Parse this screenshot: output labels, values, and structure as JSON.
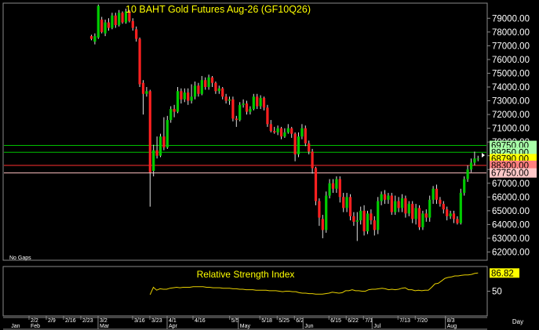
{
  "chart_data": [
    {
      "type": "candlestick",
      "title": "10 BAHT Gold Futures Aug-26 (GF10Q26)",
      "footnote": "No Gaps",
      "ylim": [
        61400,
        80100
      ],
      "y_ticks": [
        62000,
        63000,
        64000,
        65000,
        66000,
        67000,
        68000,
        69000,
        70000,
        71000,
        72000,
        73000,
        74000,
        75000,
        76000,
        77000,
        78000,
        79000
      ],
      "y_tick_labels": [
        "62000.00",
        "63000.00",
        "64000.00",
        "65000.00",
        "66000.00",
        "67000.00",
        "68000.00",
        "69000.00",
        "70000.00",
        "71000.00",
        "72000.00",
        "73000.00",
        "74000.00",
        "75000.00",
        "76000.00",
        "77000.00",
        "78000.00",
        "79000.00"
      ],
      "colors": {
        "up": "#00cc00",
        "down": "#ff2020",
        "wick": "#e0e0e0"
      },
      "levels": [
        {
          "value": 69750,
          "label": "69750.00",
          "color": "#00c000",
          "bg": "#a8ffa8"
        },
        {
          "value": 69250,
          "label": "89250.00",
          "color": "#00c000",
          "bg": "#a8ffa8"
        },
        {
          "value": 68790,
          "label": "68790.00",
          "color": null,
          "bg": "#ffff00"
        },
        {
          "value": 68300,
          "label": "88300.00",
          "color": "#ff3030",
          "bg": "#ff8080"
        },
        {
          "value": 67750,
          "label": "67750.00",
          "color": "#ffc0c0",
          "bg": "#ffc8c8"
        }
      ],
      "candles": [
        [
          0,
          77700,
          77500,
          77800,
          77400
        ],
        [
          1,
          77300,
          77700,
          77900,
          77100
        ],
        [
          2,
          77600,
          79900,
          80000,
          77500
        ],
        [
          3,
          78900,
          78000,
          79100,
          77900
        ],
        [
          4,
          77900,
          78700,
          78900,
          77700
        ],
        [
          5,
          78700,
          78300,
          79000,
          78100
        ],
        [
          6,
          78300,
          79200,
          79400,
          78200
        ],
        [
          7,
          79200,
          78500,
          79400,
          78300
        ],
        [
          8,
          78500,
          79400,
          79600,
          78400
        ],
        [
          9,
          79400,
          78700,
          79500,
          78600
        ],
        [
          10,
          78700,
          79500,
          79700,
          78600
        ],
        [
          11,
          79500,
          78800,
          79600,
          78700
        ],
        [
          12,
          78800,
          78300,
          79000,
          78100
        ],
        [
          13,
          78200,
          77500,
          78400,
          77300
        ],
        [
          14,
          77500,
          74200,
          77600,
          74000
        ],
        [
          15,
          74300,
          73500,
          74500,
          72000
        ],
        [
          16,
          73500,
          73700,
          74000,
          73300
        ],
        [
          17,
          73700,
          67800,
          73800,
          65300
        ],
        [
          18,
          67900,
          69400,
          69800,
          67500
        ],
        [
          19,
          69400,
          69000,
          70400,
          68800
        ],
        [
          20,
          69000,
          70400,
          70600,
          68900
        ],
        [
          21,
          70400,
          69600,
          71800,
          69400
        ],
        [
          22,
          69600,
          71600,
          71900,
          69500
        ],
        [
          23,
          71600,
          72400,
          72600,
          71400
        ],
        [
          24,
          72400,
          72200,
          72700,
          71800
        ],
        [
          25,
          72200,
          73700,
          74000,
          72100
        ],
        [
          26,
          73700,
          73100,
          73900,
          72800
        ],
        [
          27,
          73100,
          73600,
          73900,
          72900
        ],
        [
          28,
          73600,
          73000,
          73900,
          72700
        ],
        [
          29,
          73000,
          73300,
          74200,
          72800
        ],
        [
          30,
          73300,
          74100,
          74400,
          73100
        ],
        [
          31,
          74100,
          73500,
          74300,
          73300
        ],
        [
          32,
          73500,
          74500,
          74800,
          73400
        ],
        [
          33,
          74500,
          74000,
          74700,
          73800
        ],
        [
          34,
          74000,
          74700,
          74900,
          73800
        ],
        [
          35,
          74700,
          74300,
          74800,
          74000
        ],
        [
          36,
          74300,
          73700,
          74400,
          73500
        ],
        [
          37,
          73700,
          73900,
          74100,
          73500
        ],
        [
          38,
          73900,
          73300,
          74000,
          73100
        ],
        [
          39,
          73300,
          73000,
          73500,
          72800
        ],
        [
          40,
          73000,
          73100,
          73300,
          72700
        ],
        [
          41,
          73100,
          71700,
          73300,
          71500
        ],
        [
          42,
          71700,
          71600,
          71900,
          71100
        ],
        [
          43,
          71600,
          72700,
          72900,
          71500
        ],
        [
          44,
          72700,
          72800,
          73100,
          72500
        ],
        [
          45,
          72800,
          72200,
          73000,
          72000
        ],
        [
          46,
          72200,
          72400,
          72600,
          72000
        ],
        [
          47,
          72400,
          73300,
          73500,
          72300
        ],
        [
          48,
          73300,
          72600,
          73500,
          72400
        ],
        [
          49,
          72600,
          73200,
          73400,
          72400
        ],
        [
          50,
          73200,
          72500,
          73300,
          72300
        ],
        [
          51,
          72500,
          71300,
          72700,
          71100
        ],
        [
          52,
          71300,
          70800,
          71600,
          70700
        ],
        [
          53,
          70800,
          70700,
          71100,
          70600
        ],
        [
          54,
          70700,
          71000,
          71200,
          70500
        ],
        [
          55,
          71000,
          70400,
          71100,
          70200
        ],
        [
          56,
          70400,
          70700,
          71000,
          70300
        ],
        [
          57,
          70700,
          71000,
          71300,
          70600
        ],
        [
          58,
          71000,
          70600,
          71100,
          70300
        ],
        [
          59,
          70600,
          69100,
          70700,
          68600
        ],
        [
          60,
          69100,
          70400,
          70700,
          68900
        ],
        [
          61,
          70400,
          71000,
          71300,
          70200
        ],
        [
          62,
          71000,
          69900,
          71200,
          69700
        ],
        [
          63,
          69900,
          69300,
          70100,
          69100
        ],
        [
          64,
          69300,
          68100,
          69500,
          67700
        ],
        [
          65,
          68100,
          65700,
          68200,
          65400
        ],
        [
          66,
          65700,
          64500,
          65900,
          63900
        ],
        [
          67,
          64400,
          63600,
          64700,
          63000
        ],
        [
          68,
          63600,
          66100,
          66400,
          63400
        ],
        [
          69,
          66100,
          67000,
          67300,
          65900
        ],
        [
          70,
          67000,
          66600,
          67300,
          66300
        ],
        [
          71,
          66600,
          67300,
          67500,
          66300
        ],
        [
          72,
          67300,
          66000,
          67500,
          65600
        ],
        [
          73,
          66000,
          65200,
          66300,
          64900
        ],
        [
          74,
          65200,
          66000,
          66300,
          64900
        ],
        [
          75,
          66000,
          64600,
          66200,
          64300
        ],
        [
          76,
          64600,
          64200,
          64900,
          63900
        ],
        [
          77,
          64200,
          64300,
          64900,
          62800
        ],
        [
          78,
          64300,
          65000,
          65300,
          64000
        ],
        [
          79,
          65000,
          63500,
          65400,
          63200
        ],
        [
          80,
          63500,
          64800,
          65000,
          63300
        ],
        [
          81,
          64800,
          64300,
          65100,
          64000
        ],
        [
          82,
          64300,
          63600,
          64600,
          63200
        ],
        [
          83,
          63600,
          65700,
          66000,
          63300
        ],
        [
          84,
          65700,
          66200,
          66400,
          65400
        ],
        [
          85,
          66200,
          65800,
          66500,
          65500
        ],
        [
          86,
          65800,
          66100,
          66300,
          65500
        ],
        [
          87,
          66100,
          64900,
          66300,
          64700
        ],
        [
          88,
          64900,
          65700,
          66100,
          64700
        ],
        [
          89,
          65700,
          65200,
          66000,
          64900
        ],
        [
          90,
          65200,
          65900,
          66200,
          64900
        ],
        [
          91,
          65900,
          64800,
          66100,
          64500
        ],
        [
          92,
          64800,
          65500,
          65700,
          64600
        ],
        [
          93,
          65500,
          64400,
          65700,
          64100
        ],
        [
          94,
          64400,
          65200,
          65500,
          64000
        ],
        [
          95,
          65200,
          63800,
          65400,
          63600
        ],
        [
          96,
          63800,
          64800,
          65000,
          63600
        ],
        [
          97,
          64800,
          64500,
          65100,
          64200
        ],
        [
          98,
          64500,
          65800,
          66100,
          64200
        ],
        [
          99,
          65800,
          66600,
          66800,
          65500
        ],
        [
          100,
          66600,
          65800,
          66900,
          65500
        ],
        [
          101,
          65800,
          65500,
          66000,
          65300
        ],
        [
          102,
          65500,
          65100,
          65700,
          64800
        ],
        [
          103,
          65100,
          64600,
          65300,
          64300
        ],
        [
          104,
          64600,
          64800,
          65000,
          64400
        ],
        [
          105,
          64800,
          64400,
          65000,
          64100
        ],
        [
          106,
          64400,
          64100,
          64600,
          64000
        ],
        [
          107,
          64100,
          66300,
          66600,
          64000
        ],
        [
          108,
          66300,
          67300,
          67500,
          66100
        ],
        [
          109,
          67300,
          68000,
          68300,
          67100
        ],
        [
          110,
          68000,
          68500,
          68800,
          67800
        ],
        [
          111,
          68500,
          68800,
          69300,
          68300
        ],
        [
          112,
          68800,
          68800,
          69000,
          68600
        ]
      ]
    },
    {
      "type": "line",
      "title": "Relative Strength Index",
      "last_value": 86.82,
      "last_label": "86.82",
      "ylim": [
        0,
        100
      ],
      "y_ticks": [
        50
      ],
      "y_tick_labels": [
        "50"
      ],
      "color": "#e8d000",
      "start_index": 17,
      "values": [
        43,
        58,
        52,
        55,
        54,
        54,
        56,
        57,
        58,
        57,
        58,
        58,
        58,
        59,
        59,
        59,
        59,
        58,
        58,
        57,
        57,
        57,
        56,
        56,
        56,
        55,
        55,
        54,
        54,
        53,
        53,
        53,
        52,
        52,
        52,
        52,
        51,
        51,
        51,
        50,
        49,
        50,
        50,
        49,
        49,
        47,
        46,
        46,
        45,
        45,
        44,
        44,
        44,
        45,
        46,
        48,
        47,
        46,
        47,
        51,
        51,
        53,
        51,
        51,
        50,
        50,
        53,
        54,
        54,
        55,
        56,
        55,
        53,
        54,
        53,
        54,
        56,
        57,
        53,
        53,
        51,
        52,
        51,
        52,
        52,
        58,
        65,
        66,
        71,
        76,
        78,
        79,
        81,
        81,
        82,
        83,
        83,
        84,
        86,
        87
      ]
    }
  ],
  "x_axis": {
    "date_labels": [
      {
        "index": 0,
        "text": "2/2"
      },
      {
        "index": 8,
        "text": "2/9"
      },
      {
        "index": 16,
        "text": "2/16"
      },
      {
        "index": 24,
        "text": "2/23"
      },
      {
        "index": 32,
        "text": "3/2"
      },
      {
        "index": 48,
        "text": "3/16"
      },
      {
        "index": 56,
        "text": "3/23"
      },
      {
        "index": 64,
        "text": "4/1"
      },
      {
        "index": 76,
        "text": "4/16"
      },
      {
        "index": 93,
        "text": "5/5"
      },
      {
        "index": 107,
        "text": "5/18"
      },
      {
        "index": 115,
        "text": "5/25"
      },
      {
        "index": 123,
        "text": "6/2"
      },
      {
        "index": 139,
        "text": "6/15"
      },
      {
        "index": 147,
        "text": "6/22"
      },
      {
        "index": 155,
        "text": "7/1"
      },
      {
        "index": 171,
        "text": "7/13"
      },
      {
        "index": 179,
        "text": "7/20"
      },
      {
        "index": 193,
        "text": "8/3"
      }
    ],
    "month_labels": [
      {
        "index": -9,
        "text": "Jan"
      },
      {
        "index": 0,
        "text": "Feb"
      },
      {
        "index": 32,
        "text": "Mar"
      },
      {
        "index": 64,
        "text": "Apr"
      },
      {
        "index": 97,
        "text": "May"
      },
      {
        "index": 127,
        "text": "Jun"
      },
      {
        "index": 159,
        "text": "Jul"
      },
      {
        "index": 193,
        "text": "Aug"
      }
    ],
    "unit_label": "Day"
  }
}
